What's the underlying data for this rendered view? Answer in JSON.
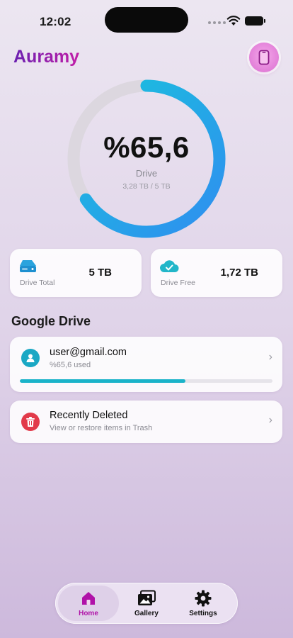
{
  "status_bar": {
    "time": "12:02"
  },
  "header": {
    "app_title": "Auramy"
  },
  "storage_ring": {
    "percent_text": "%65,6",
    "label": "Drive",
    "detail": "3,28 TB / 5 TB",
    "used_fraction": 0.656,
    "colors": {
      "start": "#2f8ef0",
      "end": "#19c3dc",
      "track": "#dcd7df"
    }
  },
  "stats": {
    "total": {
      "label": "Drive Total",
      "value": "5 TB",
      "icon": "drive-icon"
    },
    "free": {
      "label": "Drive Free",
      "value": "1,72 TB",
      "icon": "cloud-check-icon"
    }
  },
  "section": {
    "title": "Google Drive"
  },
  "account": {
    "email": "user@gmail.com",
    "usage_text": "%65,6 used",
    "usage_fraction": 0.656,
    "icon": "user-icon",
    "accent": "#1ab3c9"
  },
  "trash": {
    "title": "Recently Deleted",
    "subtitle": "View or restore items in Trash",
    "icon": "trash-icon",
    "accent": "#e23a4a"
  },
  "tab_bar": {
    "tabs": [
      {
        "label": "Home",
        "icon": "home-icon",
        "active": true
      },
      {
        "label": "Gallery",
        "icon": "gallery-icon",
        "active": false
      },
      {
        "label": "Settings",
        "icon": "gear-icon",
        "active": false
      }
    ],
    "active_color": "#b012a8"
  }
}
